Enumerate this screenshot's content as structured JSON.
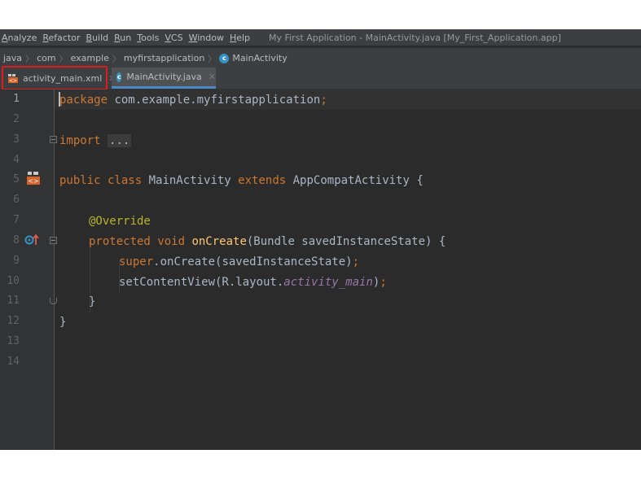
{
  "menubar": {
    "items": [
      {
        "label": "Analyze"
      },
      {
        "label": "Refactor"
      },
      {
        "label": "Build"
      },
      {
        "label": "Run"
      },
      {
        "label": "Tools"
      },
      {
        "label": "VCS"
      },
      {
        "label": "Window"
      },
      {
        "label": "Help"
      }
    ],
    "window_title": "My First Application - MainActivity.java [My_First_Application.app]"
  },
  "breadcrumb": {
    "items": [
      "java",
      "com",
      "example",
      "myfirstapplication",
      "MainActivity"
    ],
    "class_icon_letter": "c"
  },
  "tabs": [
    {
      "label": "activity_main.xml",
      "icon": "xml-layout-icon",
      "active": false,
      "highlighted": true
    },
    {
      "label": "MainActivity.java",
      "icon": "java-class-icon",
      "active": true,
      "highlighted": false
    }
  ],
  "editor": {
    "line_numbers": [
      "1",
      "2",
      "3",
      "4",
      "5",
      "6",
      "7",
      "8",
      "9",
      "10",
      "11",
      "12",
      "13",
      "14"
    ],
    "current_line": "1",
    "gutter_icons": {
      "line_7": "layout-file-icon",
      "line_10": "override-method-icon"
    },
    "code": {
      "l1_kw": "package",
      "l1_rest": " com.example.myfirstapplication",
      "l1_semi": ";",
      "l3_kw": "import",
      "l3_dots": "...",
      "l7_kw1": "public class",
      "l7_name": " MainActivity ",
      "l7_kw2": "extends",
      "l7_rest": " AppCompatActivity {",
      "l9_ann": "@Override",
      "l10_kw": "protected void",
      "l10_fn": " onCreate",
      "l10_rest": "(Bundle savedInstanceState) {",
      "l11_kw": "super",
      "l11_rest": ".onCreate(savedInstanceState)",
      "l11_semi": ";",
      "l12_rest": "setContentView(R.layout.",
      "l12_field": "activity_main",
      "l12_close": ")",
      "l12_semi": ";",
      "l13": "}",
      "l14": "}"
    }
  },
  "colors": {
    "keyword": "#cc7832",
    "annotation": "#bbb529",
    "method": "#ffc66d",
    "field": "#9876aa",
    "text": "#a9b7c6",
    "highlight_box": "#e01b1b"
  }
}
